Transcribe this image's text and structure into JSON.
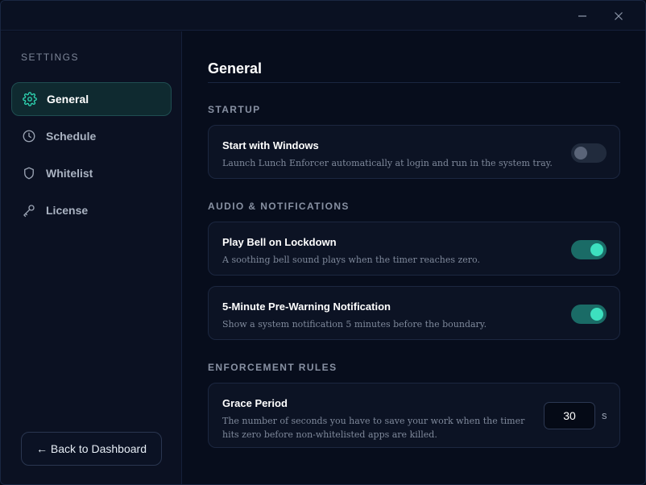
{
  "titlebar": {
    "minimize_icon": "minimize-icon",
    "close_icon": "close-icon"
  },
  "sidebar": {
    "heading": "SETTINGS",
    "items": [
      {
        "label": "General",
        "icon": "gear-icon",
        "active": true
      },
      {
        "label": "Schedule",
        "icon": "clock-icon",
        "active": false
      },
      {
        "label": "Whitelist",
        "icon": "shield-icon",
        "active": false
      },
      {
        "label": "License",
        "icon": "key-icon",
        "active": false
      }
    ],
    "back_label": "← Back to Dashboard"
  },
  "main": {
    "title": "General",
    "sections": [
      {
        "label": "STARTUP",
        "cards": [
          {
            "title": "Start with Windows",
            "desc": "Launch Lunch Enforcer automatically at login and run in the system tray.",
            "enabled": false
          }
        ]
      },
      {
        "label": "AUDIO & NOTIFICATIONS",
        "cards": [
          {
            "title": "Play Bell on Lockdown",
            "desc": "A soothing bell sound plays when the timer reaches zero.",
            "enabled": true
          },
          {
            "title": "5-Minute Pre-Warning Notification",
            "desc": "Show a system notification 5 minutes before the boundary.",
            "enabled": true
          }
        ]
      },
      {
        "label": "ENFORCEMENT RULES",
        "cards": [
          {
            "title": "Grace Period",
            "desc_line1": "The number of seconds you have to save your work when the timer",
            "desc_line2": "hits zero before non-whitelisted apps are killed.",
            "value": "30",
            "unit": "s"
          }
        ]
      }
    ]
  },
  "colors": {
    "accent": "#2ed3b0",
    "toggle_on": "#1a6b66",
    "background": "#070d1c"
  }
}
